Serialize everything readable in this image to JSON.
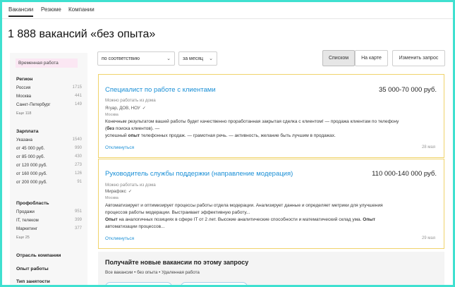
{
  "nav": {
    "tabs": [
      "Вакансии",
      "Резюме",
      "Компании"
    ],
    "active_tab": 0
  },
  "page_title": "1 888 вакансий «без опыта»",
  "sidebar": {
    "tag": "Временная работа",
    "region": {
      "title": "Регион",
      "items": [
        {
          "label": "Россия",
          "count": "1715"
        },
        {
          "label": "Москва",
          "count": "441"
        },
        {
          "label": "Санкт-Петербург",
          "count": "149"
        }
      ],
      "more": "Еще 118"
    },
    "salary": {
      "title": "Зарплата",
      "items": [
        {
          "label": "Указана",
          "count": "1540"
        },
        {
          "label": "от 45 000 руб.",
          "count": "990"
        },
        {
          "label": "от 85 000 руб.",
          "count": "430"
        },
        {
          "label": "от 120 000 руб.",
          "count": "273"
        },
        {
          "label": "от 160 000 руб.",
          "count": "126"
        },
        {
          "label": "от 200 000 руб.",
          "count": "91"
        }
      ]
    },
    "area": {
      "title": "Профобласть",
      "items": [
        {
          "label": "Продажи",
          "count": "951"
        },
        {
          "label": "IT, телеком",
          "count": "399"
        },
        {
          "label": "Маркетинг",
          "count": "377"
        }
      ],
      "more": "Еще 25"
    },
    "sections": [
      "Отрасль компании",
      "Опыт работы",
      "Тип занятости"
    ]
  },
  "controls": {
    "sort": "по соответствию",
    "period": "за месяц",
    "view_list": "Списком",
    "view_map": "На карте",
    "change_query": "Изменить запрос"
  },
  "vacancies": [
    {
      "title": "Специалист по работе с клиентами",
      "salary": "35 000-70 000 руб.",
      "remote": "Можно работать из дома",
      "company": "Ягуар, ДОВ, НОУ",
      "city": "Москва",
      "desc_lines": [
        [
          {
            "t": "Конечным результатом вашей работы будет качественно проработанная закрытая сделка с клиентом! — продажа клиентам по телефону",
            "b": false
          }
        ],
        [
          {
            "t": "(",
            "b": false
          },
          {
            "t": "без",
            "b": true
          },
          {
            "t": " поиска клиентов). —",
            "b": false
          }
        ],
        [
          {
            "t": "успешный ",
            "b": false
          },
          {
            "t": "опыт",
            "b": true
          },
          {
            "t": " телефонных продаж. — грамотная речь. — активность, желание быть лучшим в продажах.",
            "b": false
          }
        ]
      ],
      "respond": "Откликнуться",
      "date": "28 мая"
    },
    {
      "title": "Руководитель службы поддержки (направление модерация)",
      "salary": "110 000-140 000 руб.",
      "remote": "Можно работать из дома",
      "company": "Мирафокс",
      "city": "Москва",
      "desc_lines": [
        [
          {
            "t": "Автоматизирует и оптимизирует процессы работы отдела модерации. Анализирует данные и определяет метрики для улучшения",
            "b": false
          }
        ],
        [
          {
            "t": "процессов работы модерации. Выстраивает эффективную работу...",
            "b": false
          }
        ],
        [
          {
            "t": "Опыт",
            "b": true
          },
          {
            "t": " на аналогичных позициях в сфере IT от 2 лет. Высокие аналитические способности и математический склад ума. ",
            "b": false
          },
          {
            "t": "Опыт",
            "b": true
          }
        ],
        [
          {
            "t": "автоматизации процессов...",
            "b": false
          }
        ]
      ],
      "respond": "Откликнуться",
      "date": "29 мая"
    }
  ],
  "subscribe": {
    "title": "Получайте новые вакансии по этому запросу",
    "subtitle": "Все вакансии • без опыта • Удаленная работа"
  },
  "colors": {
    "frame": "#3fe0d0",
    "link": "#1a8fd6",
    "card_border": "#f0d36b",
    "tag_bg": "#fbe7f3"
  }
}
